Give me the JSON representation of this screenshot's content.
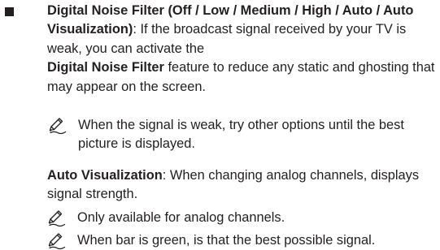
{
  "item": {
    "title": "Digital Noise Filter (Off / Low / Medium / High / Auto / Auto Visualization)",
    "intro": ": If the broadcast signal received by your TV is weak, you can activate the",
    "feature_name": "Digital Noise Filter",
    "feature_desc": " feature to reduce any static and ghosting that may appear on the screen."
  },
  "notes": [
    "When the signal is weak, try other options until the best picture is displayed.",
    "Only available for analog channels.",
    "When bar is green, is that the best possible signal."
  ],
  "auto_visualization": {
    "label": "Auto Visualization",
    "desc": ": When changing analog channels, displays signal strength."
  },
  "icons": {
    "bullet": "square-bullet-icon",
    "note": "pencil-note-icon"
  },
  "colors": {
    "text": "#231f20"
  }
}
